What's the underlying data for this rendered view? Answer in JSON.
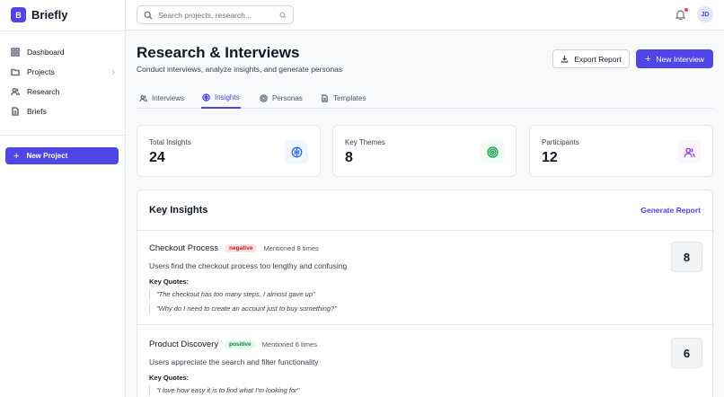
{
  "app": {
    "logo_letter": "B",
    "name": "Briefly"
  },
  "sidebar": {
    "items": [
      {
        "label": "Dashboard",
        "icon": "grid-icon"
      },
      {
        "label": "Projects",
        "icon": "folder-icon",
        "has_chevron": true
      },
      {
        "label": "Research",
        "icon": "users-icon"
      },
      {
        "label": "Briefs",
        "icon": "document-icon"
      }
    ],
    "new_project_label": "New Project"
  },
  "topbar": {
    "search_placeholder": "Search projects, research...",
    "avatar_initials": "JD"
  },
  "header": {
    "title": "Research & Interviews",
    "subtitle": "Conduct interviews, analyze insights, and generate personas",
    "export_label": "Export Report",
    "new_label": "New Interview"
  },
  "tabs": [
    {
      "label": "Interviews",
      "active": false
    },
    {
      "label": "Insights",
      "active": true
    },
    {
      "label": "Personas",
      "active": false
    },
    {
      "label": "Templates",
      "active": false
    }
  ],
  "stats": [
    {
      "label": "Total Insights",
      "value": "24",
      "icon": "brain-icon",
      "color": "#2563eb",
      "bg": "#eff6ff"
    },
    {
      "label": "Key Themes",
      "value": "8",
      "icon": "target-icon",
      "color": "#16a34a",
      "bg": "#f0fdf4"
    },
    {
      "label": "Participants",
      "value": "12",
      "icon": "users-icon",
      "color": "#9333ea",
      "bg": "#faf5ff"
    }
  ],
  "insights_panel": {
    "title": "Key Insights",
    "action_label": "Generate Report",
    "quotes_label": "Key Quotes:",
    "items": [
      {
        "title": "Checkout Process",
        "sentiment": "negative",
        "mentions": "Mentioned 8 times",
        "description": "Users find the checkout process too lengthy and confusing",
        "quotes": [
          "\"The checkout has too many steps, I almost gave up\"",
          "\"Why do I need to create an account just to buy something?\""
        ],
        "count": "8"
      },
      {
        "title": "Product Discovery",
        "sentiment": "positive",
        "mentions": "Mentioned 6 times",
        "description": "Users appreciate the search and filter functionality",
        "quotes": [
          "\"I love how easy it is to find what I'm looking for\""
        ],
        "count": "6"
      }
    ]
  },
  "colors": {
    "accent": "#4f46e5",
    "negative": "#b91c1c",
    "positive": "#15803d"
  }
}
